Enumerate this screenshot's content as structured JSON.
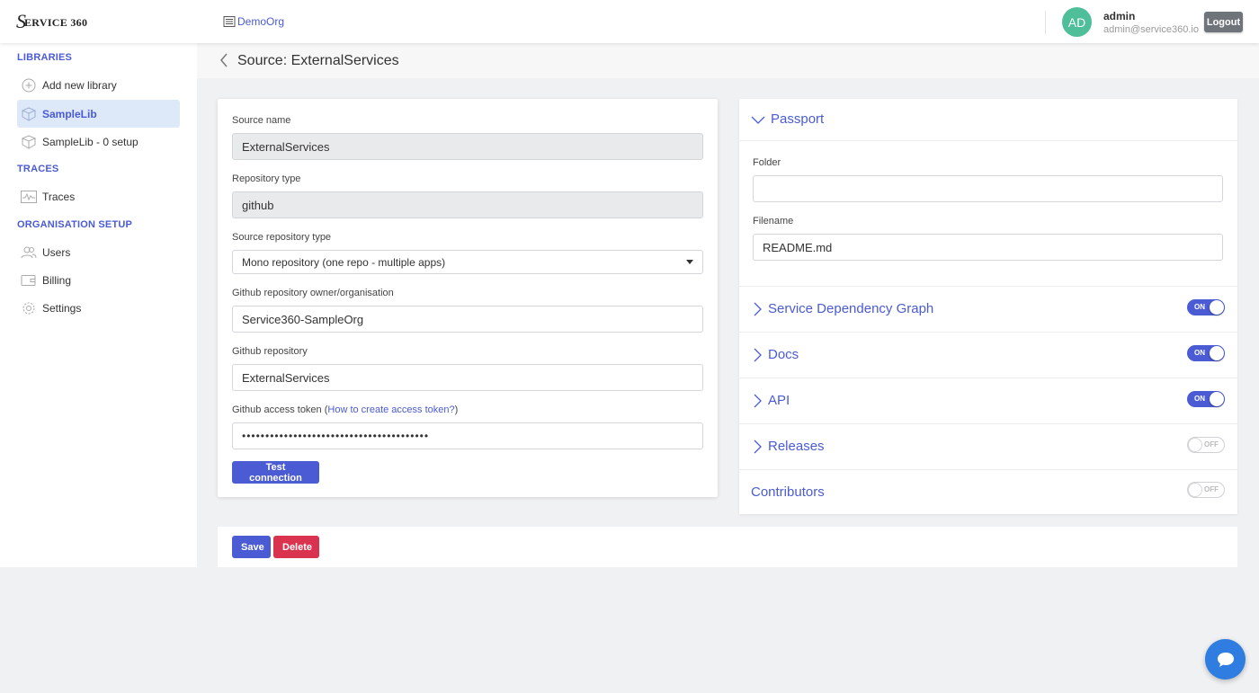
{
  "header": {
    "logo_s": "S",
    "logo_text": "ERVICE 360",
    "org_name": "DemoOrg",
    "avatar_initials": "AD",
    "user_name": "admin",
    "user_email": "admin@service360.io",
    "logout_label": "Logout"
  },
  "sidebar": {
    "sections": {
      "libraries": "LIBRARIES",
      "traces": "TRACES",
      "org_setup": "ORGANISATION SETUP"
    },
    "items": [
      {
        "label": "Add new library",
        "icon": "plus-circle-icon"
      },
      {
        "label": "SampleLib",
        "icon": "cube-icon",
        "active": true
      },
      {
        "label": "SampleLib - 0 setup",
        "icon": "cube-icon"
      },
      {
        "label": "Traces",
        "icon": "pulse-icon"
      },
      {
        "label": "Users",
        "icon": "users-icon"
      },
      {
        "label": "Billing",
        "icon": "wallet-icon"
      },
      {
        "label": "Settings",
        "icon": "gear-icon"
      }
    ]
  },
  "page": {
    "title": "Source: ExternalServices"
  },
  "form": {
    "source_name_label": "Source name",
    "source_name_value": "ExternalServices",
    "repo_type_label": "Repository type",
    "repo_type_value": "github",
    "source_repo_type_label": "Source repository type",
    "source_repo_type_value": "Mono repository (one repo - multiple apps)",
    "owner_label": "Github repository owner/organisation",
    "owner_value": "Service360-SampleOrg",
    "repo_label": "Github repository",
    "repo_value": "ExternalServices",
    "token_label": "Github access token (",
    "token_link": "How to create access token?",
    "token_label_end": ")",
    "token_value": "••••••••••••••••••••••••••••••••••••••••",
    "test_button": "Test connection"
  },
  "passport": {
    "title": "Passport",
    "folder_label": "Folder",
    "folder_value": "",
    "filename_label": "Filename",
    "filename_value": "README.md"
  },
  "features": [
    {
      "label": "Service Dependency Graph",
      "state": "ON",
      "on": true
    },
    {
      "label": "Docs",
      "state": "ON",
      "on": true
    },
    {
      "label": "API",
      "state": "ON",
      "on": true
    },
    {
      "label": "Releases",
      "state": "OFF",
      "on": false
    },
    {
      "label": "Contributors",
      "state": "OFF",
      "on": false
    }
  ],
  "actions": {
    "save": "Save",
    "delete": "Delete"
  },
  "colors": {
    "accent": "#4a5bd4",
    "danger": "#d9334f",
    "avatar": "#4fbf9a",
    "chat": "#2f7de1"
  }
}
